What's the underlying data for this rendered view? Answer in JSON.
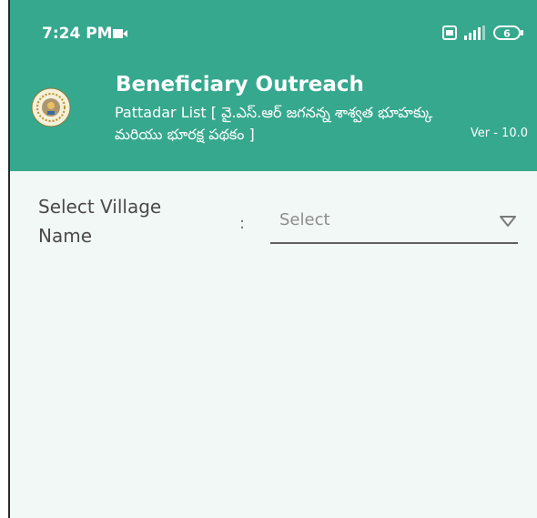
{
  "status_bar": {
    "time": "7:24 PM",
    "icons": [
      "video-camera-icon",
      "sim-card-icon",
      "signal-icon",
      "battery-icon"
    ],
    "battery_level": "6"
  },
  "header": {
    "title": "Beneficiary Outreach",
    "subtitle": "Pattadar List [ వై.ఎస్.ఆర్ జగనన్న శాశ్వత భూహక్కు మరియు భూరక్ష పథకం ]",
    "version": "Ver - 10.0",
    "logo": "andhra-pradesh-emblem-icon",
    "background_color": "#35a88e"
  },
  "form": {
    "village_label": "Select Village Name",
    "separator": ":",
    "village_select": {
      "value": "Select",
      "icon": "dropdown-triangle-icon"
    }
  }
}
